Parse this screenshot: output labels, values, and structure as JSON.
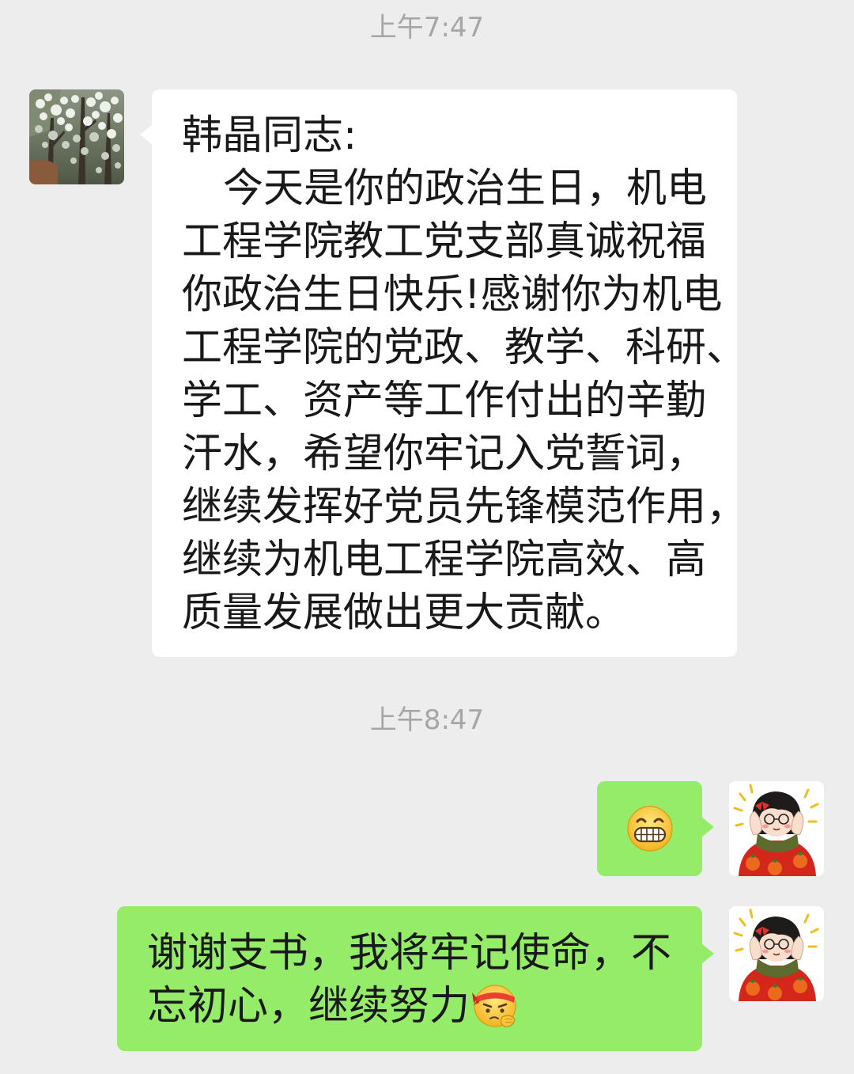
{
  "chat": {
    "theme": {
      "background": "#EDEDED",
      "bubble_incoming": "#FFFFFF",
      "bubble_outgoing": "#95EC69",
      "timestamp_color": "#A6A6A6",
      "text_color": "#191919"
    },
    "timestamps": [
      "上午7:47",
      "上午8:47"
    ],
    "messages": [
      {
        "direction": "incoming",
        "avatar_icon": "tree-blossom-photo",
        "lines": [
          "韩晶同志:",
          "今天是你的政治生日，机电",
          "工程学院教工党支部真诚祝福",
          "你政治生日快乐!感谢你为机电",
          "工程学院的党政、教学、科研、",
          "学工、资产等工作付出的辛勤",
          "汗水，希望你牢记入党誓词，",
          "继续发挥好党员先锋模范作用，",
          "继续为机电工程学院高效、高",
          "质量发展做出更大贡献。"
        ]
      },
      {
        "direction": "outgoing",
        "avatar_icon": "cartoon-girl-persimmon",
        "emoji_icon": "grinning-face"
      },
      {
        "direction": "outgoing",
        "avatar_icon": "cartoon-girl-persimmon",
        "lines": [
          "谢谢支书，我将牢记使命，不",
          "忘初心，继续努力"
        ],
        "trailing_emoji_icon": "fighting-face"
      }
    ]
  }
}
